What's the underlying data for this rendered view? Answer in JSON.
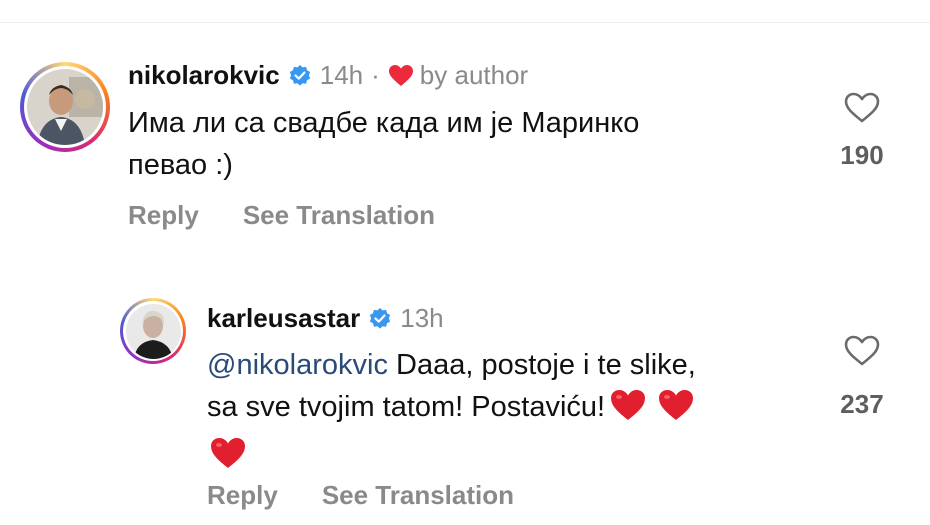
{
  "comments": [
    {
      "username": "nikolarokvic",
      "time": "14h",
      "separator": "·",
      "liked_by": "by author",
      "text_lines": [
        "Има ли са свадбе када им је Маринко",
        "певао :)"
      ],
      "likes": "190",
      "reply_label": "Reply",
      "translate_label": "See Translation"
    },
    {
      "username": "karleusastar",
      "time": "13h",
      "mention": "@nikolarokvic",
      "text_line1": " Daaa, postoje i te slike,",
      "text_line2": "sa sve tvojim tatom! Postaviću!",
      "likes": "237",
      "reply_label": "Reply",
      "translate_label": "See Translation"
    }
  ],
  "colors": {
    "verified": "#3897f0",
    "heart_red": "#ed2a3c",
    "muted": "#8a8a8a",
    "mention": "#2a4a78"
  },
  "icons": [
    "verified-badge-icon",
    "heart-filled-icon",
    "like-heart-outline-icon"
  ]
}
